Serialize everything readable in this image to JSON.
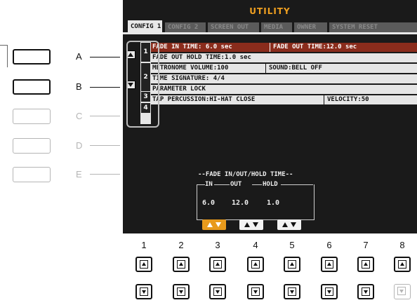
{
  "screen": {
    "title": "UTILITY",
    "tabs": [
      "CONFIG 1",
      "CONFIG 2",
      "SCREEN OUT",
      "MEDIA",
      "OWNER",
      "SYSTEM RESET"
    ],
    "active_tab": "CONFIG 1",
    "rows": [
      {
        "num": "1",
        "cells": [
          "FADE IN TIME: 6.0 sec",
          "FADE OUT TIME:12.0 sec"
        ],
        "selected": true
      },
      {
        "num": "",
        "cells": [
          "FADE OUT HOLD TIME:1.0 sec"
        ],
        "selected": false
      },
      {
        "num": "2",
        "cells": [
          "METRONOME VOLUME:100",
          "SOUND:BELL OFF"
        ],
        "selected": false
      },
      {
        "num": "",
        "cells": [
          "TIME SIGNATURE:  4/4"
        ],
        "selected": false
      },
      {
        "num": "3",
        "cells": [
          "PARAMETER LOCK"
        ],
        "selected": false
      },
      {
        "num": "4",
        "cells": [
          "TAP PERCUSSION:HI-HAT CLOSE",
          "VELOCITY:50"
        ],
        "selected": false
      }
    ],
    "fade_group": {
      "title": "FADE IN/OUT/HOLD TIME",
      "headers": [
        "IN",
        "OUT",
        "HOLD"
      ],
      "values": [
        "6.0",
        "12.0",
        "1.0"
      ]
    }
  },
  "left_buttons": [
    "A",
    "B",
    "C",
    "D",
    "E"
  ],
  "bottom_buttons": [
    "1",
    "2",
    "3",
    "4",
    "5",
    "6",
    "7",
    "8"
  ],
  "colors": {
    "accent": "#e89a1c",
    "title": "#f0a020",
    "selected_row": "#8a2c1c",
    "screen_bg": "#1a1a1a"
  }
}
